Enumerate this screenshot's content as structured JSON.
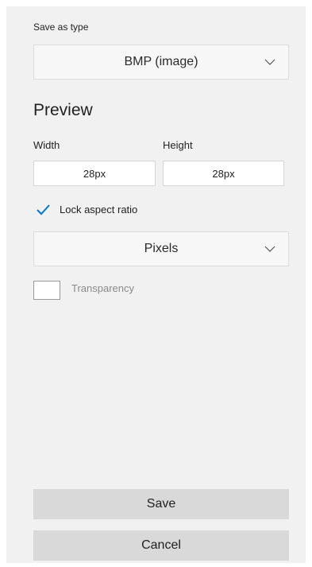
{
  "save_as_type": {
    "label": "Save as type",
    "selected": "BMP (image)"
  },
  "preview": {
    "title": "Preview",
    "width_label": "Width",
    "height_label": "Height",
    "width_value": "28px",
    "height_value": "28px"
  },
  "lock_aspect": {
    "label": "Lock aspect ratio",
    "checked": true
  },
  "units": {
    "selected": "Pixels"
  },
  "transparency": {
    "label": "Transparency",
    "checked": false
  },
  "buttons": {
    "save": "Save",
    "cancel": "Cancel"
  },
  "colors": {
    "panel_bg": "#f1f1f1",
    "checkbox_accent": "#0078d4"
  }
}
